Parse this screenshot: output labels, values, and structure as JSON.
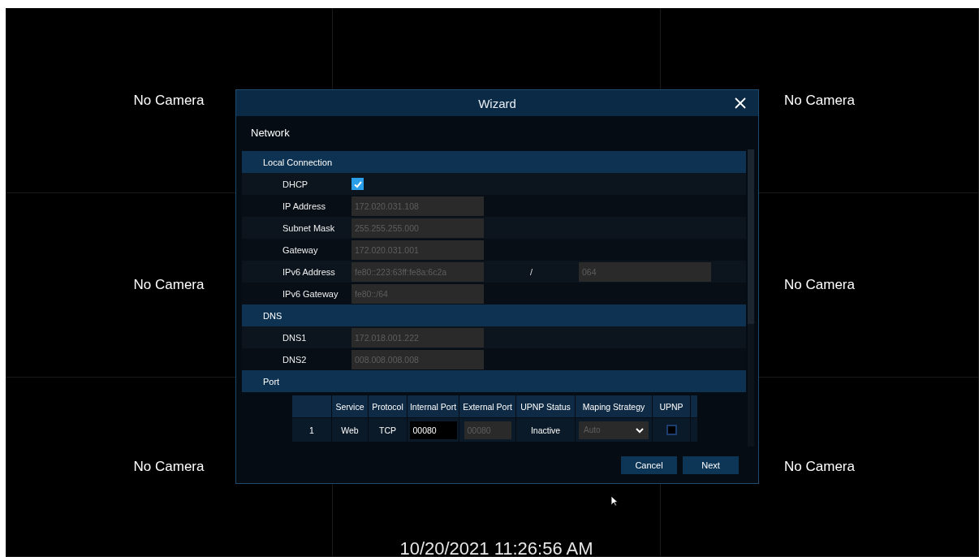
{
  "camera_rows": [
    {
      "left": "No Camera",
      "right": "No Camera"
    },
    {
      "left": "No Camera",
      "right": "No Camera"
    },
    {
      "left": "No Camera",
      "right": "No Camera"
    }
  ],
  "timestamp": "10/20/2021 11:26:56 AM",
  "dialog": {
    "title": "Wizard",
    "section": "Network",
    "groups": [
      {
        "title": "Local Connection",
        "rows": [
          {
            "kind": "checkbox",
            "label": "DHCP",
            "checked": true
          },
          {
            "kind": "field",
            "label": "IP Address",
            "value": "172.020.031.108",
            "disabled": true
          },
          {
            "kind": "field",
            "label": "Subnet Mask",
            "value": "255.255.255.000",
            "disabled": true
          },
          {
            "kind": "field",
            "label": "Gateway",
            "value": "172.020.031.001",
            "disabled": true
          },
          {
            "kind": "field_pair",
            "label": "IPv6 Address",
            "value": "fe80::223:63ff:fe8a:6c2a",
            "separator": "/",
            "value_2": "064",
            "disabled": true
          },
          {
            "kind": "field",
            "label": "IPv6 Gateway",
            "value": "fe80::/64",
            "disabled": true
          }
        ]
      },
      {
        "title": "DNS",
        "rows": [
          {
            "kind": "field",
            "label": "DNS1",
            "value": "172.018.001.222",
            "disabled": true
          },
          {
            "kind": "field",
            "label": "DNS2",
            "value": "008.008.008.008",
            "disabled": true
          }
        ]
      },
      {
        "title": "Port",
        "table": {
          "columns": [
            "Service",
            "Protocol",
            "Internal Port",
            "External Port",
            "UPNP Status",
            "Maping Strategy",
            "UPNP"
          ],
          "rows": [
            {
              "index": "1",
              "service": "Web",
              "protocol": "TCP",
              "internal_port": "00080",
              "internal_disabled": false,
              "external_port": "00080",
              "external_disabled": true,
              "status": "Inactive",
              "strategy": "Auto",
              "strategy_disabled": true,
              "upnp": false
            }
          ]
        }
      }
    ],
    "buttons": [
      "Cancel",
      "Next"
    ]
  }
}
